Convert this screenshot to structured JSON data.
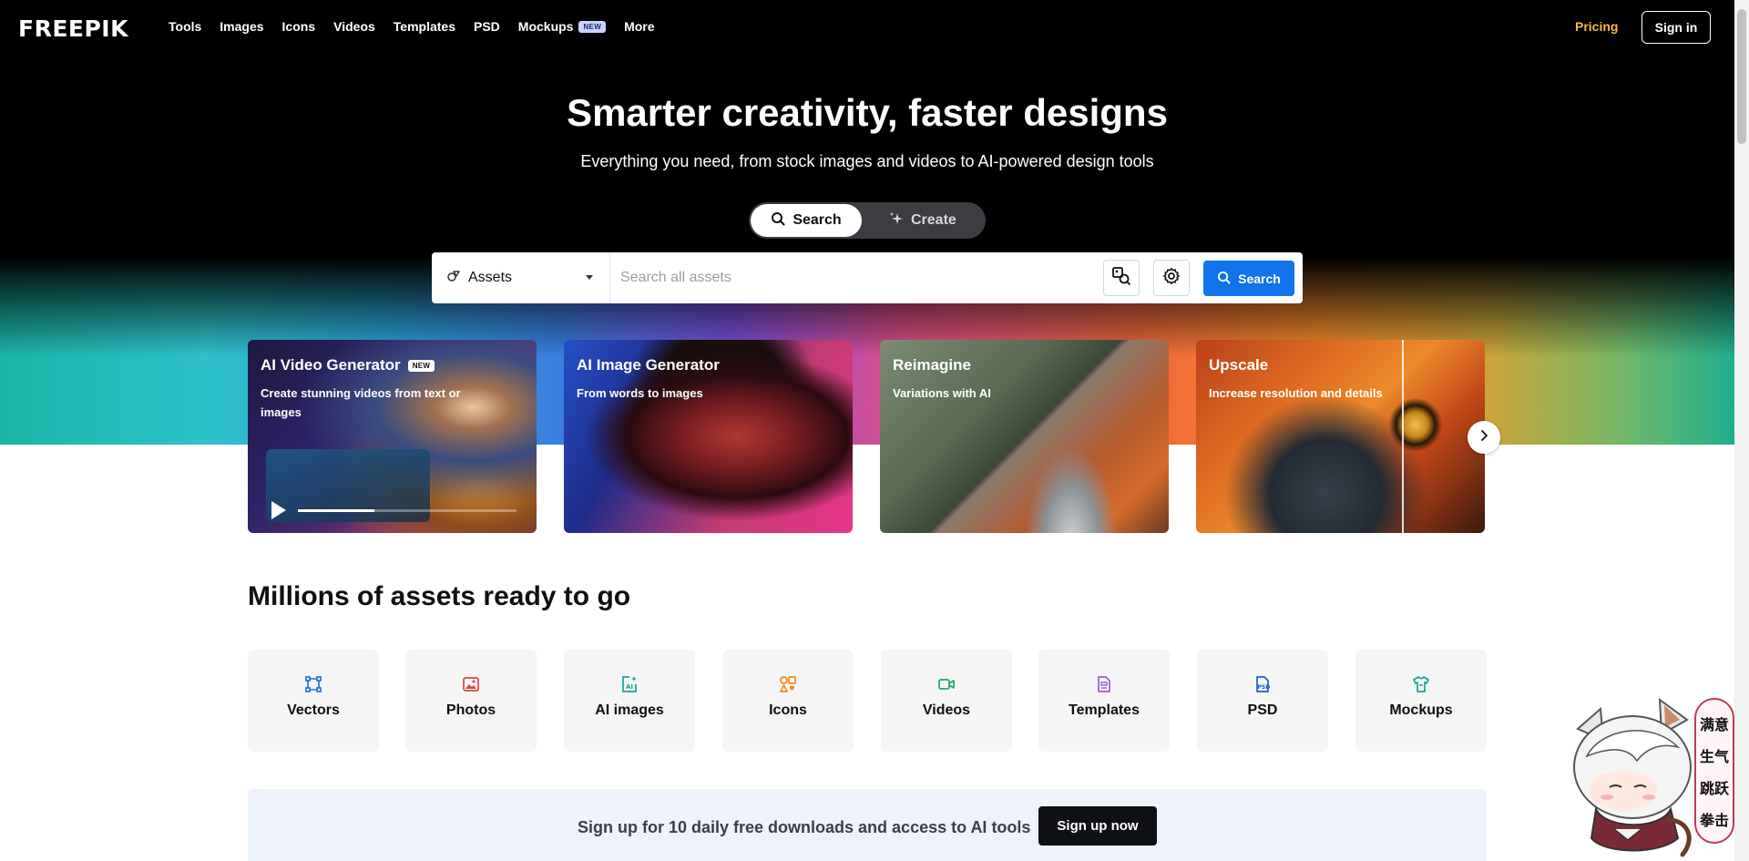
{
  "brand": {
    "logo": "FREEPIK"
  },
  "nav": {
    "items": [
      {
        "label": "Tools"
      },
      {
        "label": "Images"
      },
      {
        "label": "Icons"
      },
      {
        "label": "Videos"
      },
      {
        "label": "Templates"
      },
      {
        "label": "PSD"
      },
      {
        "label": "Mockups",
        "badge": "NEW"
      },
      {
        "label": "More"
      }
    ],
    "pricing": "Pricing",
    "signin": "Sign in"
  },
  "hero": {
    "title": "Smarter creativity, faster designs",
    "subtitle": "Everything you need, from stock images and videos to AI-powered design tools",
    "mode_search": "Search",
    "mode_create": "Create"
  },
  "search": {
    "category": "Assets",
    "placeholder": "Search all assets",
    "button": "Search"
  },
  "cards": [
    {
      "title": "AI Video Generator",
      "badge": "NEW",
      "subtitle": "Create stunning videos from text or images",
      "video_progress": 0.35
    },
    {
      "title": "AI Image Generator",
      "subtitle": "From words to images"
    },
    {
      "title": "Reimagine",
      "subtitle": "Variations with AI"
    },
    {
      "title": "Upscale",
      "subtitle": "Increase resolution and details"
    }
  ],
  "assets": {
    "title": "Millions of assets ready to go",
    "tiles": [
      {
        "label": "Vectors",
        "icon": "vector-icon",
        "color": "#1d6ed8"
      },
      {
        "label": "Photos",
        "icon": "photo-icon",
        "color": "#e0463c"
      },
      {
        "label": "AI images",
        "icon": "ai-image-icon",
        "color": "#18a39a"
      },
      {
        "label": "Icons",
        "icon": "icons-icon",
        "color": "#f28a1e"
      },
      {
        "label": "Videos",
        "icon": "video-icon",
        "color": "#1fa868"
      },
      {
        "label": "Templates",
        "icon": "template-icon",
        "color": "#9a5cd6"
      },
      {
        "label": "PSD",
        "icon": "psd-icon",
        "color": "#1d5fc8"
      },
      {
        "label": "Mockups",
        "icon": "mockup-icon",
        "color": "#17a398"
      }
    ]
  },
  "signup": {
    "text": "Sign up for 10 daily free downloads and access to AI tools",
    "button": "Sign up now"
  },
  "mascot_menu": [
    "满意",
    "生气",
    "跳跃",
    "拳击"
  ]
}
